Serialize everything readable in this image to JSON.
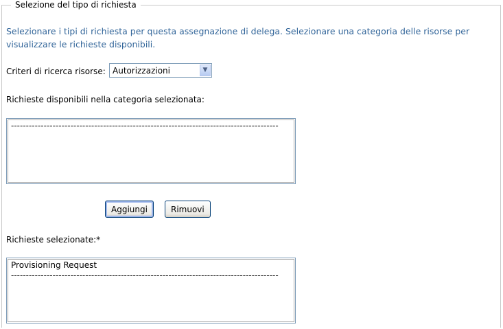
{
  "section": {
    "legend": "Selezione del tipo di richiesta"
  },
  "intro": "Selezionare i tipi di richiesta per questa assegnazione di delega. Selezionare una categoria delle risorse per visualizzare le richieste disponibili.",
  "criteria": {
    "label": "Criteri di ricerca risorse:",
    "selected": "Autorizzazioni"
  },
  "available": {
    "label": "Richieste disponibili nella categoria selezionata:",
    "items": [
      "-----------------------------------------------------------------------------------------------------"
    ]
  },
  "buttons": {
    "add": "Aggiungi",
    "remove": "Rimuovi"
  },
  "selected": {
    "label": "Richieste selezionate:*",
    "items": [
      "Provisioning Request",
      "-----------------------------------------------------------------------------------------------------"
    ]
  }
}
